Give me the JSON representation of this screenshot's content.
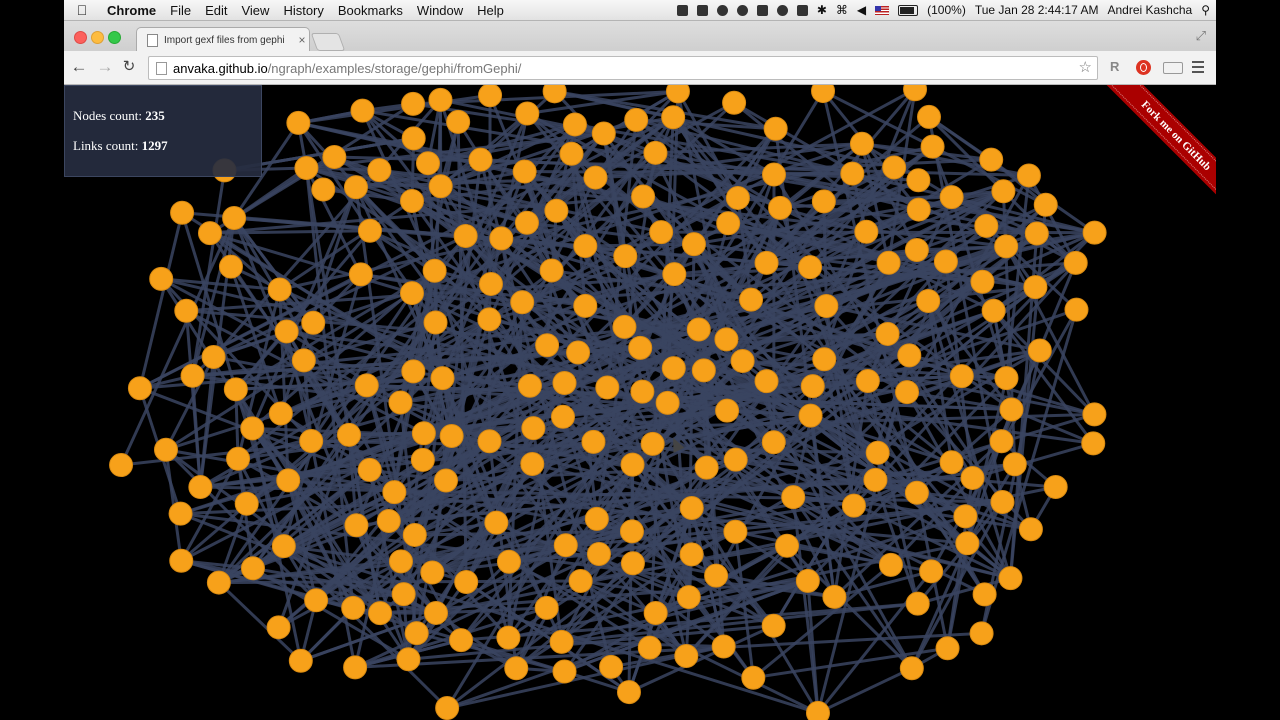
{
  "menubar": {
    "app_name": "Chrome",
    "items": [
      "File",
      "Edit",
      "View",
      "History",
      "Bookmarks",
      "Window",
      "Help"
    ],
    "battery_text": "(100%)",
    "clock": "Tue Jan 28  2:44:17 AM",
    "user": "Andrei Kashcha"
  },
  "browser": {
    "tab_title": "Import gexf files from gephi",
    "url_host": "anvaka.github.io",
    "url_path": "/ngraph/examples/storage/gephi/fromGephi/"
  },
  "page": {
    "nodes_label": "Nodes count:",
    "nodes_count": "235",
    "links_label": "Links count:",
    "links_count": "1297",
    "ribbon_text": "Fork me on GitHub",
    "colors": {
      "node": "#f7a11a",
      "node_stroke": "#d98a10",
      "link": "#3a4460",
      "background": "#000000"
    }
  }
}
